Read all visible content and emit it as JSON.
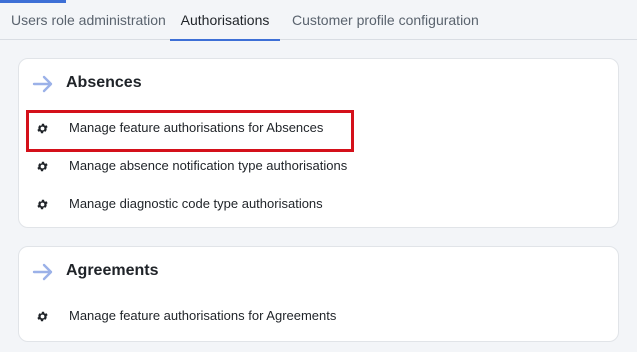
{
  "tabs": [
    {
      "label": "Users role administration",
      "active": false
    },
    {
      "label": "Authorisations",
      "active": true
    },
    {
      "label": "Customer profile configuration",
      "active": false
    }
  ],
  "sections": [
    {
      "title": "Absences",
      "icon": "arrow-right-icon",
      "items": [
        {
          "label": "Manage feature authorisations for Absences",
          "icon": "gear-icon",
          "highlighted": true
        },
        {
          "label": "Manage absence notification type authorisations",
          "icon": "gear-icon"
        },
        {
          "label": "Manage diagnostic code type authorisations",
          "icon": "gear-icon"
        }
      ]
    },
    {
      "title": "Agreements",
      "icon": "arrow-right-icon",
      "items": [
        {
          "label": "Manage feature authorisations for Agreements",
          "icon": "gear-icon"
        }
      ]
    }
  ],
  "colors": {
    "accent": "#3d6fd6",
    "arrow": "#9bb1e8",
    "highlight": "#d4101a"
  }
}
